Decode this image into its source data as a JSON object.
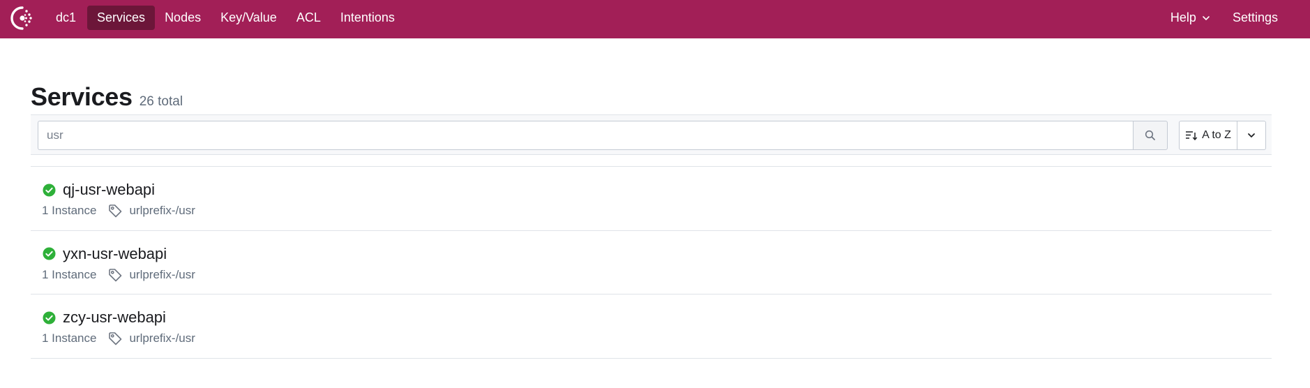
{
  "nav": {
    "datacenter": "dc1",
    "items": [
      {
        "label": "Services",
        "active": true
      },
      {
        "label": "Nodes",
        "active": false
      },
      {
        "label": "Key/Value",
        "active": false
      },
      {
        "label": "ACL",
        "active": false
      },
      {
        "label": "Intentions",
        "active": false
      }
    ],
    "help_label": "Help",
    "settings_label": "Settings"
  },
  "header": {
    "title": "Services",
    "count": "26 total"
  },
  "filter": {
    "search_value": "usr",
    "sort_label": "A to Z"
  },
  "services": [
    {
      "name": "qj-usr-webapi",
      "instances": "1 Instance",
      "tag": "urlprefix-/usr",
      "status": "passing"
    },
    {
      "name": "yxn-usr-webapi",
      "instances": "1 Instance",
      "tag": "urlprefix-/usr",
      "status": "passing"
    },
    {
      "name": "zcy-usr-webapi",
      "instances": "1 Instance",
      "tag": "urlprefix-/usr",
      "status": "passing"
    }
  ],
  "colors": {
    "brand": "#a21f57",
    "brand_active": "#6c1639",
    "status_passing": "#2eb039"
  }
}
